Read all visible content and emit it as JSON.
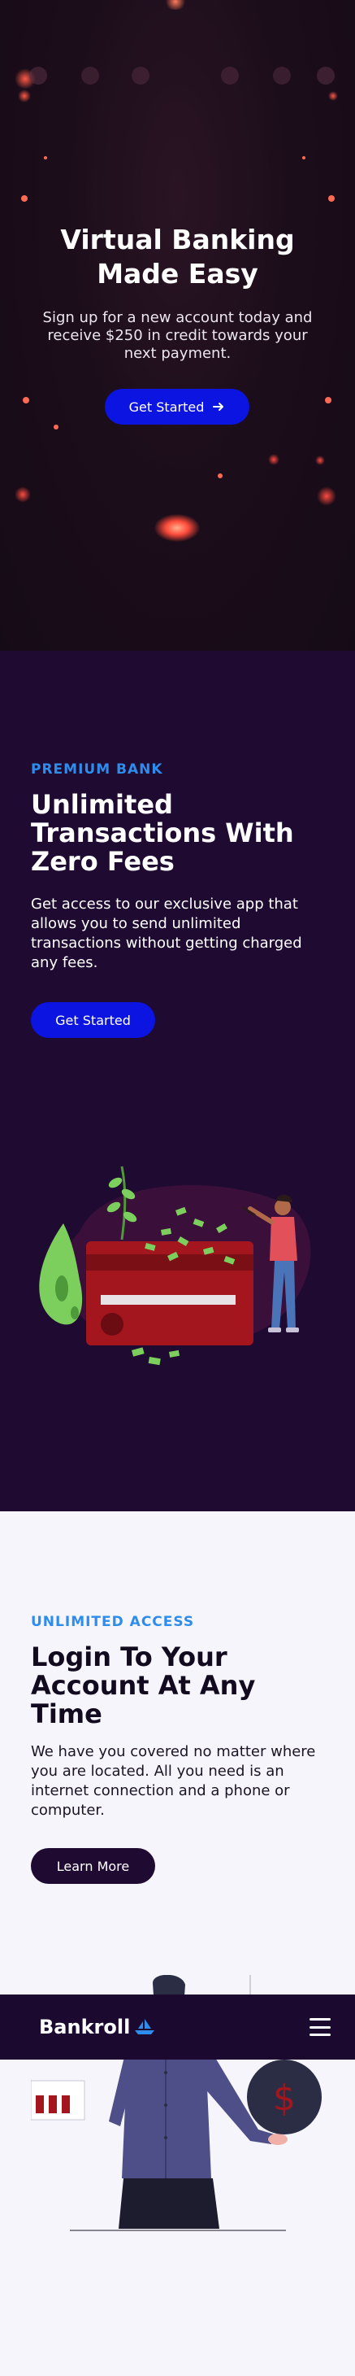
{
  "hero": {
    "title_line1": "Virtual Banking",
    "title_line2": "Made Easy",
    "subtitle": "Sign up for a new account today and receive $250 in credit towards your next payment.",
    "cta_label": "Get Started",
    "cta_icon": "arrow-right-icon"
  },
  "premium": {
    "eyebrow": "PREMIUM BANK",
    "title": "Unlimited Transactions With Zero Fees",
    "body": "Get access to our exclusive app that allows you to send unlimited transactions without getting charged any fees.",
    "cta_label": "Get Started"
  },
  "access": {
    "eyebrow": "UNLIMITED ACCESS",
    "title": "Login To Your Account At Any Time",
    "body": "We have you covered no matter where you are located. All you need is an internet connection and a phone or computer.",
    "cta_label": "Learn More"
  },
  "navbar": {
    "logo_text": "Bankroll",
    "menu_icon": "hamburger-menu-icon"
  },
  "colors": {
    "accent_blue": "#0b14e0",
    "eyebrow_blue": "#2e8dec",
    "dark_purple": "#1f0a32",
    "nav_purple": "#1c0930",
    "light_bg": "#f6f5fb"
  }
}
